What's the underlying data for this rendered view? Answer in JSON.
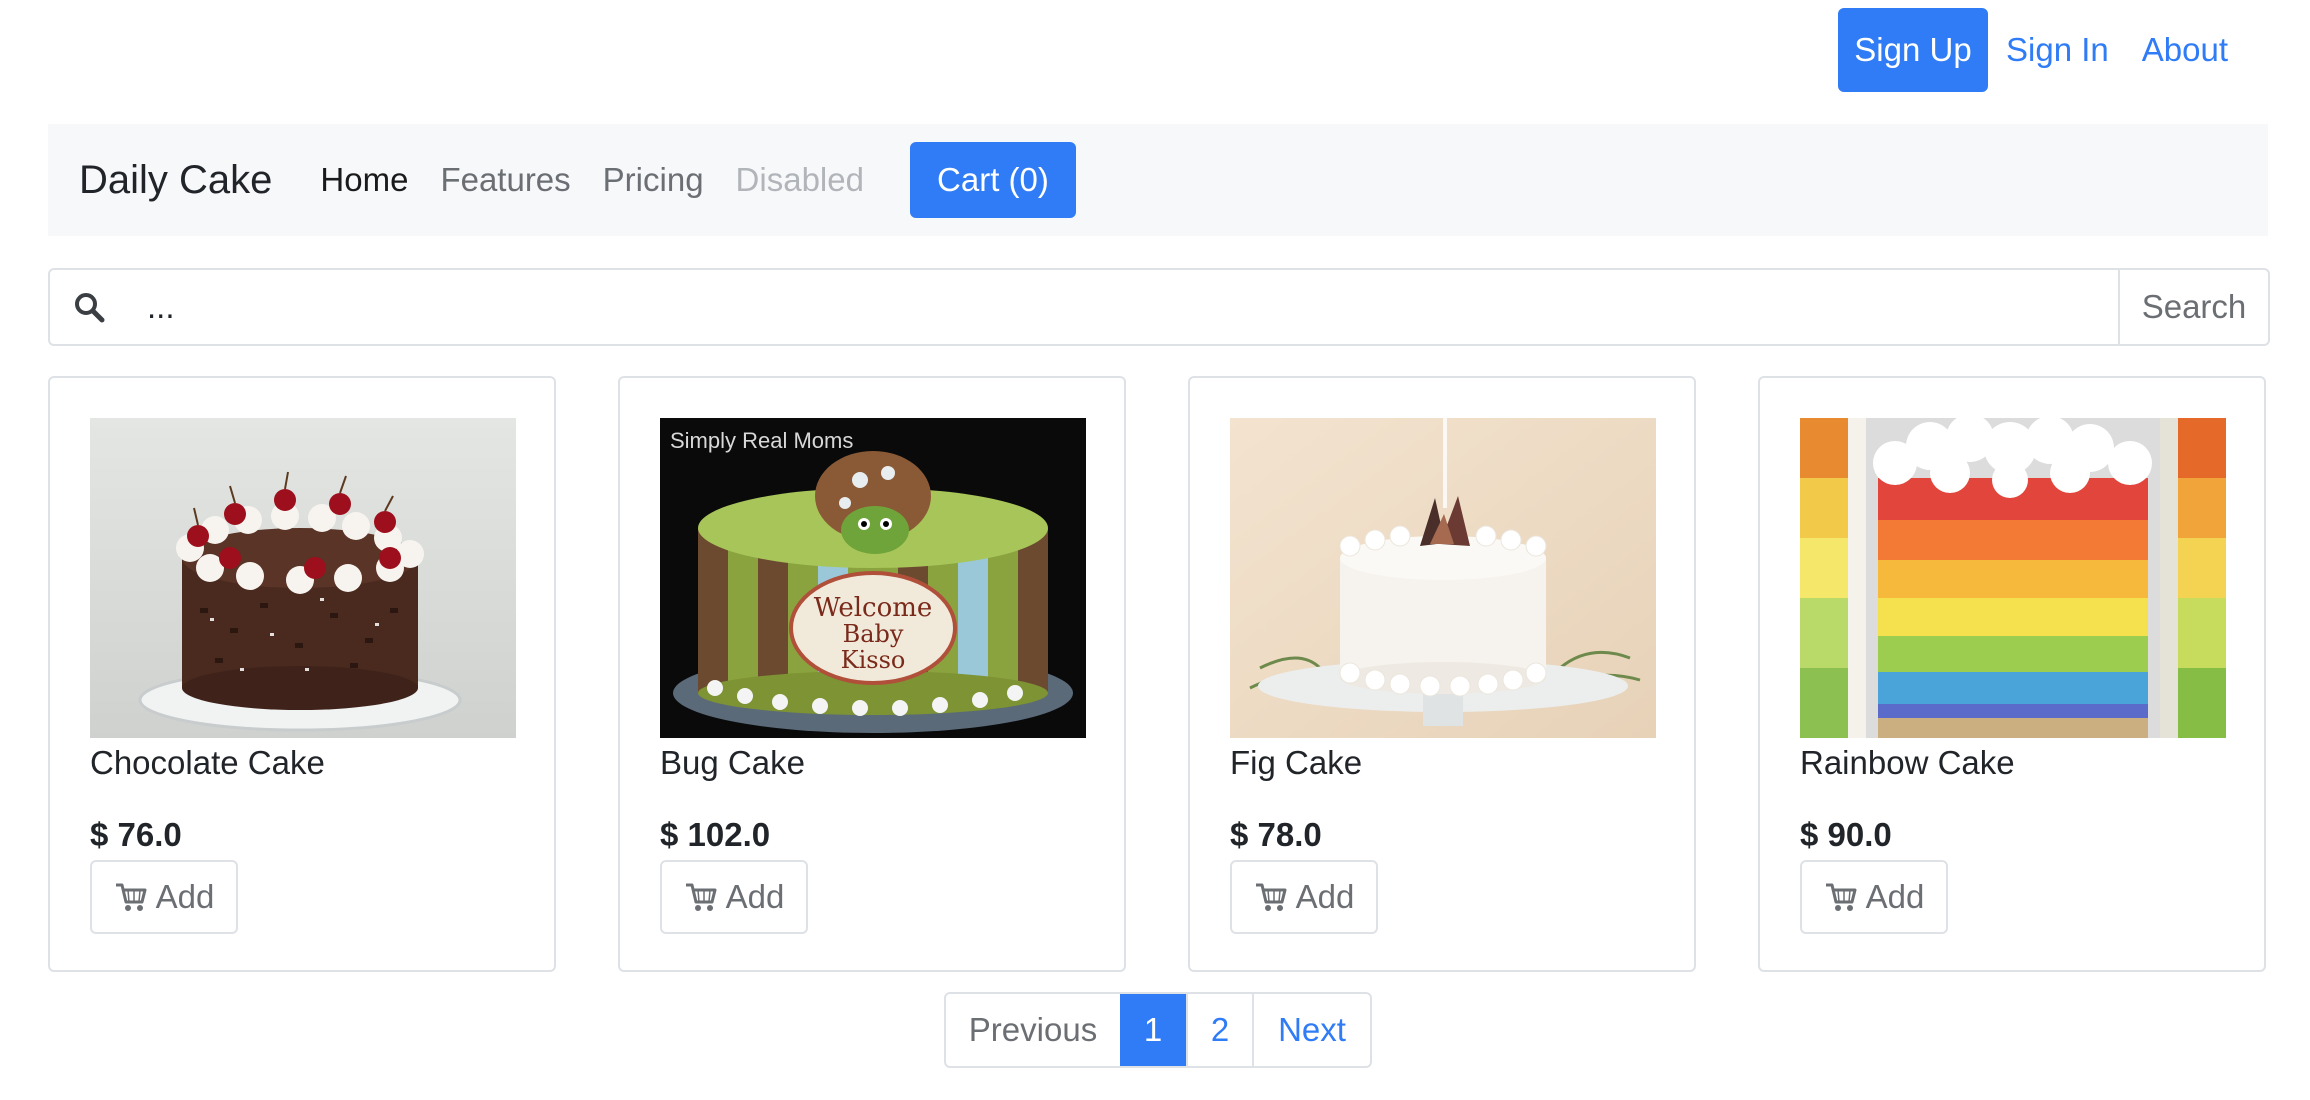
{
  "top_nav": {
    "signup": "Sign Up",
    "signin": "Sign In",
    "about": "About"
  },
  "navbar": {
    "brand": "Daily Cake",
    "links": [
      "Home",
      "Features",
      "Pricing",
      "Disabled"
    ],
    "cart": "Cart (0)"
  },
  "search": {
    "placeholder": "...",
    "icon": "search-icon",
    "button": "Search"
  },
  "products": [
    {
      "name": "Chocolate Cake",
      "price": "$ 76.0",
      "add_label": "Add"
    },
    {
      "name": "Bug Cake",
      "price": "$ 102.0",
      "add_label": "Add",
      "image_caption": "Simply Real Moms",
      "cake_text": "Welcome Baby Kisso"
    },
    {
      "name": "Fig Cake",
      "price": "$ 78.0",
      "add_label": "Add"
    },
    {
      "name": "Rainbow Cake",
      "price": "$ 90.0",
      "add_label": "Add"
    }
  ],
  "pagination": {
    "previous": "Previous",
    "pages": [
      "1",
      "2"
    ],
    "current": "1",
    "next": "Next"
  },
  "colors": {
    "primary": "#2f7cf6",
    "navbar_bg": "#f7f8fa",
    "border": "#dee2e6"
  }
}
